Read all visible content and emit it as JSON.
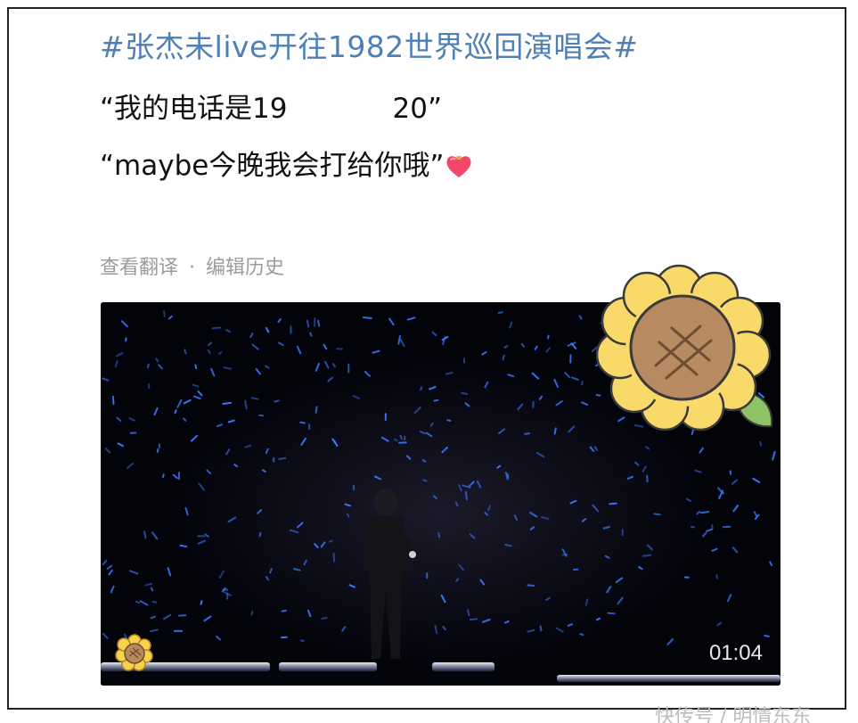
{
  "post": {
    "hashtag": "#张杰未live开往1982世界巡回演唱会#",
    "line1_prefix": "“我的电话是19",
    "line1_suffix": "20”",
    "line2": "“maybe今晚我会打给你哦”",
    "line2_emoji": "heart-with-bow-icon"
  },
  "meta": {
    "translate": "查看翻译",
    "separator": "·",
    "edit_history": "编辑历史"
  },
  "video": {
    "duration": "01:04",
    "colors": {
      "background": "#03030a",
      "lightstick": "#3a78ff"
    }
  },
  "sticker": {
    "icon": "sunflower-icon"
  },
  "watermark": "快传号 / 明情东东"
}
